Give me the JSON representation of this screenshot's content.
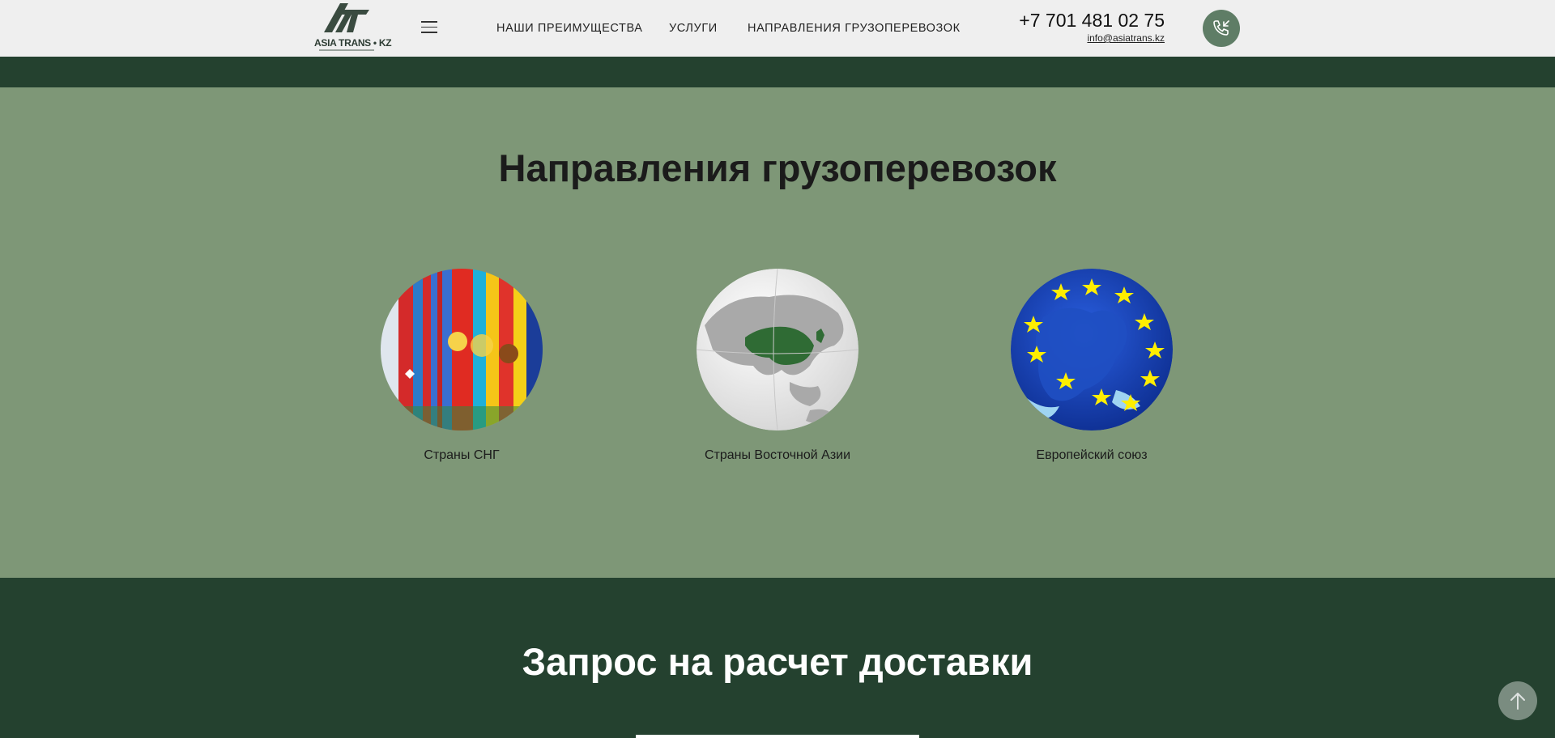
{
  "header": {
    "logo_text": "ASIA TRANS • KZ",
    "nav": [
      {
        "label": "НАШИ ПРЕИМУЩЕСТВА"
      },
      {
        "label": "УСЛУГИ"
      },
      {
        "label": "НАПРАВЛЕНИЯ ГРУЗОПЕРЕВОЗОК"
      }
    ],
    "phone": "+7 701 481 02 75",
    "email": "info@asiatrans.kz"
  },
  "directions": {
    "title": "Направления грузоперевозок",
    "items": [
      {
        "label": "Страны СНГ",
        "icon": "cis-flags-icon"
      },
      {
        "label": "Страны Восточной Азии",
        "icon": "east-asia-globe-icon"
      },
      {
        "label": "Европейский союз",
        "icon": "eu-globe-icon"
      }
    ]
  },
  "request": {
    "title": "Запрос на расчет доставки"
  },
  "colors": {
    "header_bg": "#efefef",
    "dark_green": "#24412f",
    "section_green": "#7e9777",
    "accent_green": "#5f7d66"
  }
}
